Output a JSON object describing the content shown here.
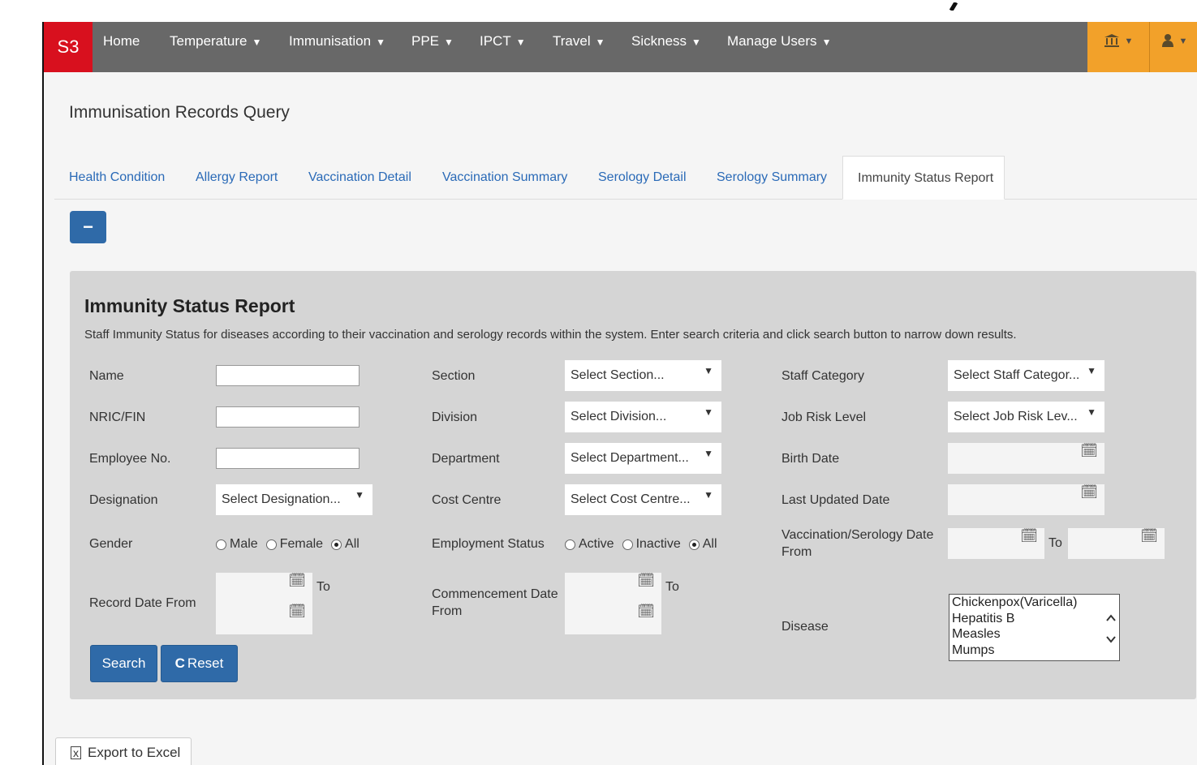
{
  "navbar": {
    "brand": "S3",
    "items": [
      {
        "label": "Home",
        "caret": ""
      },
      {
        "label": "Temperature",
        "caret": "▼"
      },
      {
        "label": "Immunisation",
        "caret": "▼"
      },
      {
        "label": "PPE",
        "caret": "▼"
      },
      {
        "label": "IPCT",
        "caret": "▼"
      },
      {
        "label": "Travel",
        "caret": "▼"
      },
      {
        "label": "Sickness",
        "caret": "▼"
      },
      {
        "label": "Manage Users",
        "caret": "▼"
      }
    ],
    "right_icons": [
      "institution-icon",
      "user-icon"
    ],
    "caret": "▼",
    "brand_color": "#d8101e",
    "accent_color": "#f2a12a"
  },
  "page": {
    "title": "Immunisation Records Query",
    "collapse_symbol": "−"
  },
  "tabs": [
    "Health Condition",
    "Allergy Report",
    "Vaccination Detail",
    "Vaccination Summary",
    "Serology Detail",
    "Serology Summary",
    "Immunity Status Report"
  ],
  "active_tab": "Immunity Status Report",
  "panel": {
    "title": "Immunity Status Report",
    "description": "Staff Immunity Status for diseases according to their vaccination and serology records within the system. Enter search criteria and click search button to narrow down results."
  },
  "form": {
    "name_label": "Name",
    "nric_label": "NRIC/FIN",
    "employee_no_label": "Employee No.",
    "designation_label": "Designation",
    "designation_placeholder": "Select Designation...",
    "gender_label": "Gender",
    "gender_options": [
      "Male",
      "Female",
      "All"
    ],
    "gender_selected": "All",
    "record_date_label": "Record Date From",
    "to_label": "To",
    "section_label": "Section",
    "section_placeholder": "Select Section...",
    "division_label": "Division",
    "division_placeholder": "Select Division...",
    "department_label": "Department",
    "department_placeholder": "Select Department...",
    "cost_centre_label": "Cost Centre",
    "cost_centre_placeholder": "Select Cost Centre...",
    "employment_status_label": "Employment Status",
    "employment_options": [
      "Active",
      "Inactive",
      "All"
    ],
    "employment_selected": "All",
    "commencement_label_1": "Commencement Date",
    "commencement_label_2": "From",
    "staff_category_label": "Staff Category",
    "staff_category_placeholder": "Select Staff Categor...",
    "job_risk_label": "Job Risk Level",
    "job_risk_placeholder": "Select Job Risk Lev...",
    "birth_date_label": "Birth Date",
    "last_updated_label": "Last Updated Date",
    "vacc_serology_label_1": "Vaccination/Serology Date",
    "vacc_serology_label_2": "From",
    "disease_label": "Disease",
    "disease_options": [
      "Chickenpox(Varicella)",
      "Hepatitis B",
      "Measles",
      "Mumps"
    ],
    "search_label": "Search",
    "reset_label": "Reset",
    "reset_symbol": "C"
  },
  "export_label": "Export to Excel"
}
